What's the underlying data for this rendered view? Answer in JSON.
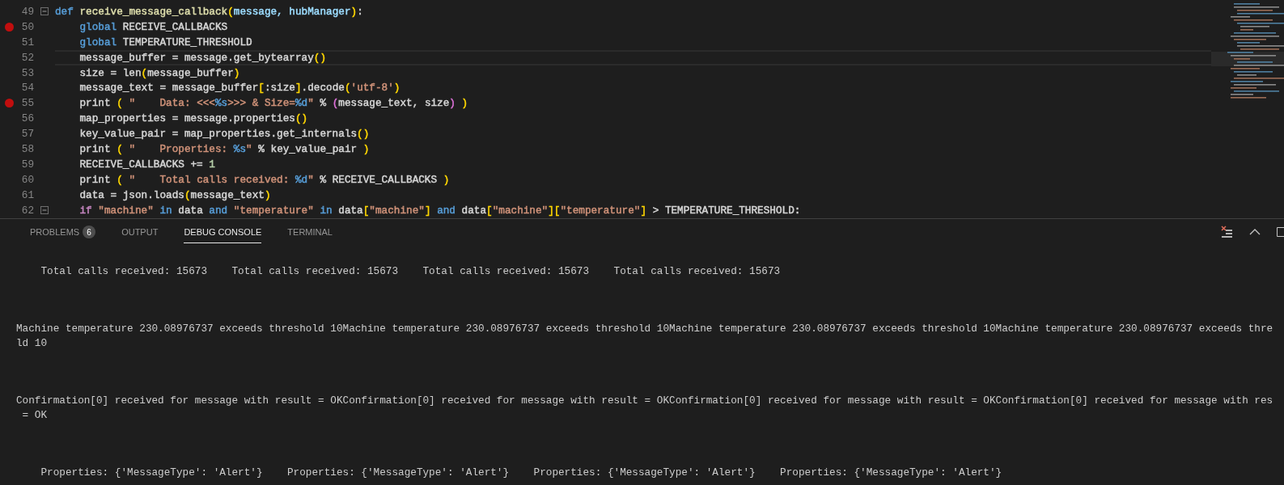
{
  "editor": {
    "lines": [
      {
        "number": "49",
        "breakpoint": false,
        "fold": true,
        "current": false,
        "tokens": [
          {
            "t": "def ",
            "color": "#569cd6"
          },
          {
            "t": "receive_message_callback",
            "color": "#dcdcaa"
          },
          {
            "t": "(",
            "color": "#ffd700"
          },
          {
            "t": "message, ",
            "color": "#9cdcfe"
          },
          {
            "t": "hubManager",
            "color": "#9cdcfe"
          },
          {
            "t": ")",
            "color": "#ffd700"
          },
          {
            "t": ":",
            "color": "#d4d4d4"
          }
        ]
      },
      {
        "number": "50",
        "breakpoint": true,
        "fold": false,
        "current": false,
        "tokens": [
          {
            "t": "    global",
            "color": "#569cd6"
          },
          {
            "t": " RECEIVE_CALLBACKS",
            "color": "#d4d4d4"
          }
        ]
      },
      {
        "number": "51",
        "breakpoint": false,
        "fold": false,
        "current": false,
        "tokens": [
          {
            "t": "    global",
            "color": "#569cd6"
          },
          {
            "t": " TEMPERATURE_THRESHOLD",
            "color": "#d4d4d4"
          }
        ]
      },
      {
        "number": "52",
        "breakpoint": false,
        "fold": false,
        "current": true,
        "tokens": [
          {
            "t": "    message_buffer = message.get_bytearray",
            "color": "#d4d4d4"
          },
          {
            "t": "()",
            "color": "#ffd700"
          }
        ]
      },
      {
        "number": "53",
        "breakpoint": false,
        "fold": false,
        "current": false,
        "tokens": [
          {
            "t": "    size = len",
            "color": "#d4d4d4"
          },
          {
            "t": "(",
            "color": "#ffd700"
          },
          {
            "t": "message_buffer",
            "color": "#d4d4d4"
          },
          {
            "t": ")",
            "color": "#ffd700"
          }
        ]
      },
      {
        "number": "54",
        "breakpoint": false,
        "fold": false,
        "current": false,
        "tokens": [
          {
            "t": "    message_text = message_buffer",
            "color": "#d4d4d4"
          },
          {
            "t": "[",
            "color": "#ffd700"
          },
          {
            "t": ":size",
            "color": "#d4d4d4"
          },
          {
            "t": "]",
            "color": "#ffd700"
          },
          {
            "t": ".decode",
            "color": "#d4d4d4"
          },
          {
            "t": "(",
            "color": "#ffd700"
          },
          {
            "t": "'utf-8'",
            "color": "#ce9178"
          },
          {
            "t": ")",
            "color": "#ffd700"
          }
        ]
      },
      {
        "number": "55",
        "breakpoint": true,
        "fold": false,
        "current": false,
        "tokens": [
          {
            "t": "    print ",
            "color": "#d4d4d4"
          },
          {
            "t": "( ",
            "color": "#ffd700"
          },
          {
            "t": "\"    Data: <<<",
            "color": "#ce9178"
          },
          {
            "t": "%s",
            "color": "#569cd6"
          },
          {
            "t": ">>> & Size=",
            "color": "#ce9178"
          },
          {
            "t": "%d",
            "color": "#569cd6"
          },
          {
            "t": "\"",
            "color": "#ce9178"
          },
          {
            "t": " % ",
            "color": "#d4d4d4"
          },
          {
            "t": "(",
            "color": "#da70d6"
          },
          {
            "t": "message_text, size",
            "color": "#d4d4d4"
          },
          {
            "t": ") ",
            "color": "#da70d6"
          },
          {
            "t": ")",
            "color": "#ffd700"
          }
        ]
      },
      {
        "number": "56",
        "breakpoint": false,
        "fold": false,
        "current": false,
        "tokens": [
          {
            "t": "    map_properties = message.properties",
            "color": "#d4d4d4"
          },
          {
            "t": "()",
            "color": "#ffd700"
          }
        ]
      },
      {
        "number": "57",
        "breakpoint": false,
        "fold": false,
        "current": false,
        "tokens": [
          {
            "t": "    key_value_pair = map_properties.get_internals",
            "color": "#d4d4d4"
          },
          {
            "t": "()",
            "color": "#ffd700"
          }
        ]
      },
      {
        "number": "58",
        "breakpoint": false,
        "fold": false,
        "current": false,
        "tokens": [
          {
            "t": "    print ",
            "color": "#d4d4d4"
          },
          {
            "t": "( ",
            "color": "#ffd700"
          },
          {
            "t": "\"    Properties: ",
            "color": "#ce9178"
          },
          {
            "t": "%s",
            "color": "#569cd6"
          },
          {
            "t": "\"",
            "color": "#ce9178"
          },
          {
            "t": " % key_value_pair ",
            "color": "#d4d4d4"
          },
          {
            "t": ")",
            "color": "#ffd700"
          }
        ]
      },
      {
        "number": "59",
        "breakpoint": false,
        "fold": false,
        "current": false,
        "tokens": [
          {
            "t": "    RECEIVE_CALLBACKS += ",
            "color": "#d4d4d4"
          },
          {
            "t": "1",
            "color": "#b5cea8"
          }
        ]
      },
      {
        "number": "60",
        "breakpoint": false,
        "fold": false,
        "current": false,
        "tokens": [
          {
            "t": "    print ",
            "color": "#d4d4d4"
          },
          {
            "t": "( ",
            "color": "#ffd700"
          },
          {
            "t": "\"    Total calls received: ",
            "color": "#ce9178"
          },
          {
            "t": "%d",
            "color": "#569cd6"
          },
          {
            "t": "\"",
            "color": "#ce9178"
          },
          {
            "t": " % RECEIVE_CALLBACKS ",
            "color": "#d4d4d4"
          },
          {
            "t": ")",
            "color": "#ffd700"
          }
        ]
      },
      {
        "number": "61",
        "breakpoint": false,
        "fold": false,
        "current": false,
        "tokens": [
          {
            "t": "    data = json.loads",
            "color": "#d4d4d4"
          },
          {
            "t": "(",
            "color": "#ffd700"
          },
          {
            "t": "message_text",
            "color": "#d4d4d4"
          },
          {
            "t": ")",
            "color": "#ffd700"
          }
        ]
      },
      {
        "number": "62",
        "breakpoint": false,
        "fold": true,
        "current": false,
        "tokens": [
          {
            "t": "    if ",
            "color": "#c586c0"
          },
          {
            "t": "\"machine\" ",
            "color": "#ce9178"
          },
          {
            "t": "in",
            "color": "#569cd6"
          },
          {
            "t": " data ",
            "color": "#d4d4d4"
          },
          {
            "t": "and ",
            "color": "#569cd6"
          },
          {
            "t": "\"temperature\" ",
            "color": "#ce9178"
          },
          {
            "t": "in",
            "color": "#569cd6"
          },
          {
            "t": " data",
            "color": "#d4d4d4"
          },
          {
            "t": "[",
            "color": "#ffd700"
          },
          {
            "t": "\"machine\"",
            "color": "#ce9178"
          },
          {
            "t": "] ",
            "color": "#ffd700"
          },
          {
            "t": "and",
            "color": "#569cd6"
          },
          {
            "t": " data",
            "color": "#d4d4d4"
          },
          {
            "t": "[",
            "color": "#ffd700"
          },
          {
            "t": "\"machine\"",
            "color": "#ce9178"
          },
          {
            "t": "][",
            "color": "#ffd700"
          },
          {
            "t": "\"temperature\"",
            "color": "#ce9178"
          },
          {
            "t": "]",
            "color": "#ffd700"
          },
          {
            "t": " > TEMPERATURE_THRESHOLD:",
            "color": "#d4d4d4"
          }
        ]
      }
    ]
  },
  "panel": {
    "tabs": [
      {
        "label": "PROBLEMS",
        "badge": "6",
        "selected": false
      },
      {
        "label": "OUTPUT",
        "selected": false
      },
      {
        "label": "DEBUG CONSOLE",
        "selected": true
      },
      {
        "label": "TERMINAL",
        "selected": false
      }
    ],
    "console": {
      "blocks": [
        {
          "lines": [
            "    Total calls received: 15673    Total calls received: 15673    Total calls received: 15673    Total calls received: 15673"
          ]
        },
        {
          "lines": [
            "Machine temperature 230.08976737 exceeds threshold 10Machine temperature 230.08976737 exceeds threshold 10Machine temperature 230.08976737 exceeds threshold 10Machine temperature 230.08976737 exceeds thre",
            "ld 10"
          ]
        },
        {
          "lines": [
            "Confirmation[0] received for message with result = OKConfirmation[0] received for message with result = OKConfirmation[0] received for message with result = OKConfirmation[0] received for message with res",
            " = OK"
          ]
        },
        {
          "lines": [
            "    Properties: {'MessageType': 'Alert'}    Properties: {'MessageType': 'Alert'}    Properties: {'MessageType': 'Alert'}    Properties: {'MessageType': 'Alert'}"
          ]
        }
      ]
    }
  }
}
